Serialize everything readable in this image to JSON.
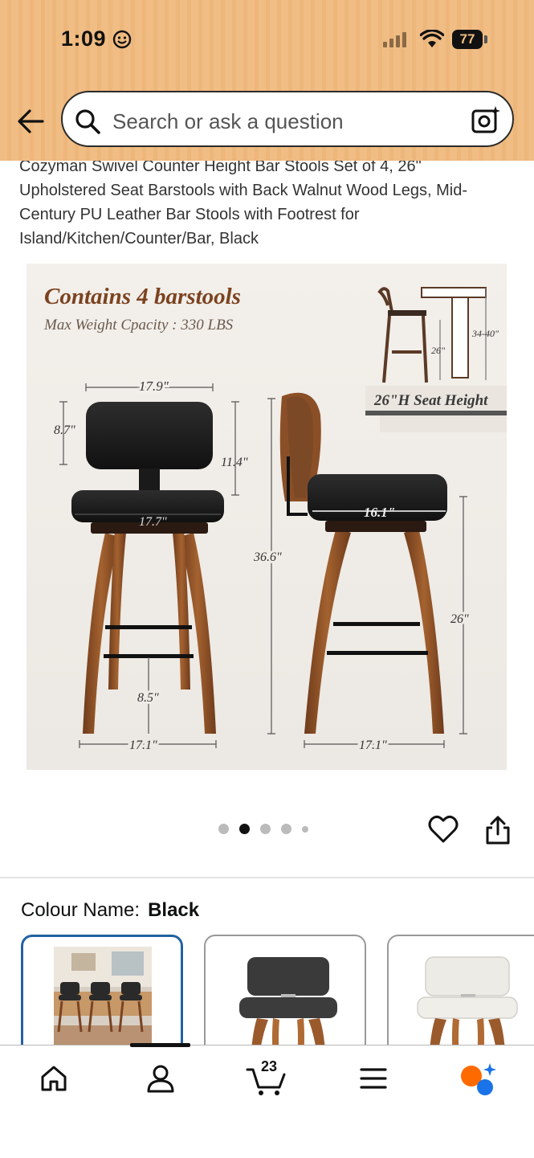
{
  "status": {
    "time": "1:09",
    "battery": "77"
  },
  "search": {
    "placeholder": "Search or ask a question"
  },
  "product": {
    "title": "Cozyman Swivel Counter Height Bar Stools Set of 4, 26\" Upholstered Seat Barstools with Back Walnut Wood Legs, Mid-Century PU Leather Bar Stools with Footrest for Island/Kitchen/Counter/Bar, Black"
  },
  "image": {
    "headline": "Contains 4 barstools",
    "subline": "Max Weight Cpacity : 330 LBS",
    "seat_height_label": "26\"H Seat Height",
    "inset_height_label": "26\"",
    "inset_range_label": "34-40\"",
    "dims": {
      "back_width": "17.9\"",
      "back_height": "8.7\"",
      "back_gap": "11.4\"",
      "seat_width": "17.7\"",
      "total_height": "36.6\"",
      "footrest_height": "8.5\"",
      "base_width_front": "17.1\"",
      "side_seat_depth": "16.1\"",
      "seat_height": "26\"",
      "base_width_side": "17.1\""
    }
  },
  "gallery": {
    "dot_count": 5,
    "active_index": 1
  },
  "colour": {
    "label": "Colour Name:",
    "value": "Black"
  },
  "nav": {
    "cart_count": "23"
  },
  "colors": {
    "header_bg": "#f0bd84",
    "selected_swatch": "#2162a1",
    "alexa_orange": "#ff6a00",
    "alexa_blue": "#1a73e8"
  }
}
